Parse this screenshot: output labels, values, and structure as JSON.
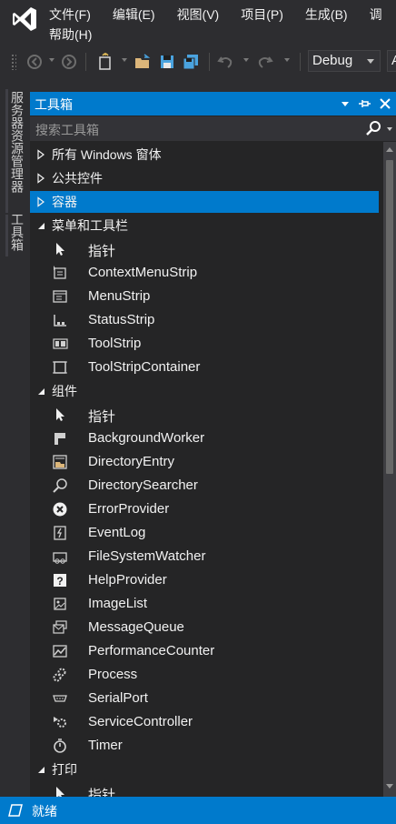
{
  "menubar": {
    "items": [
      "文件(F)",
      "编辑(E)",
      "视图(V)",
      "项目(P)",
      "生成(B)",
      "调"
    ],
    "row2": [
      "帮助(H)"
    ]
  },
  "toolbar": {
    "config": "Debug",
    "platform": "A"
  },
  "side_tabs": [
    "服务器资源管理器",
    "工具箱"
  ],
  "toolbox": {
    "title": "工具箱",
    "search_placeholder": "搜索工具箱",
    "rows": [
      {
        "kind": "cat",
        "expanded": false,
        "label": "所有 Windows 窗体"
      },
      {
        "kind": "cat",
        "expanded": false,
        "label": "公共控件"
      },
      {
        "kind": "cat",
        "expanded": false,
        "label": "容器",
        "selected": true
      },
      {
        "kind": "cat",
        "expanded": true,
        "label": "菜单和工具栏"
      },
      {
        "kind": "item",
        "icon": "pointer-icon",
        "label": "指针"
      },
      {
        "kind": "item",
        "icon": "context-menu-strip-icon",
        "label": "ContextMenuStrip"
      },
      {
        "kind": "item",
        "icon": "menu-strip-icon",
        "label": "MenuStrip"
      },
      {
        "kind": "item",
        "icon": "status-strip-icon",
        "label": "StatusStrip"
      },
      {
        "kind": "item",
        "icon": "tool-strip-icon",
        "label": "ToolStrip"
      },
      {
        "kind": "item",
        "icon": "tool-strip-container-icon",
        "label": "ToolStripContainer"
      },
      {
        "kind": "cat",
        "expanded": true,
        "label": "组件"
      },
      {
        "kind": "item",
        "icon": "pointer-icon",
        "label": "指针"
      },
      {
        "kind": "item",
        "icon": "background-worker-icon",
        "label": "BackgroundWorker"
      },
      {
        "kind": "item",
        "icon": "directory-entry-icon",
        "label": "DirectoryEntry"
      },
      {
        "kind": "item",
        "icon": "directory-searcher-icon",
        "label": "DirectorySearcher"
      },
      {
        "kind": "item",
        "icon": "error-provider-icon",
        "label": "ErrorProvider"
      },
      {
        "kind": "item",
        "icon": "event-log-icon",
        "label": "EventLog"
      },
      {
        "kind": "item",
        "icon": "file-system-watcher-icon",
        "label": "FileSystemWatcher"
      },
      {
        "kind": "item",
        "icon": "help-provider-icon",
        "label": "HelpProvider"
      },
      {
        "kind": "item",
        "icon": "image-list-icon",
        "label": "ImageList"
      },
      {
        "kind": "item",
        "icon": "message-queue-icon",
        "label": "MessageQueue"
      },
      {
        "kind": "item",
        "icon": "performance-counter-icon",
        "label": "PerformanceCounter"
      },
      {
        "kind": "item",
        "icon": "process-icon",
        "label": "Process"
      },
      {
        "kind": "item",
        "icon": "serial-port-icon",
        "label": "SerialPort"
      },
      {
        "kind": "item",
        "icon": "service-controller-icon",
        "label": "ServiceController"
      },
      {
        "kind": "item",
        "icon": "timer-icon",
        "label": "Timer"
      },
      {
        "kind": "cat",
        "expanded": true,
        "label": "打印"
      },
      {
        "kind": "item",
        "icon": "pointer-icon",
        "label": "指针"
      }
    ]
  },
  "statusbar": {
    "text": "就绪"
  },
  "colors": {
    "accent": "#007acc",
    "background": "#2d2d30",
    "panel": "#252526"
  }
}
